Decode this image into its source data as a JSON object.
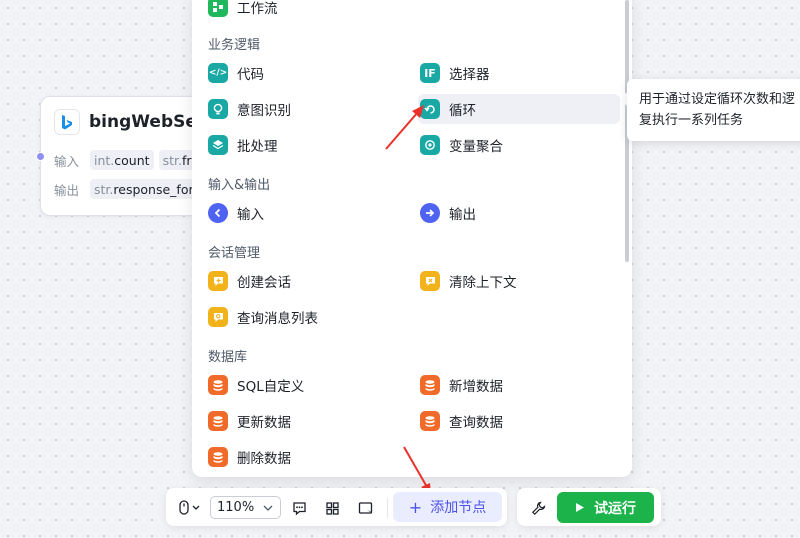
{
  "node": {
    "title": "bingWebSea",
    "input_label": "输入",
    "output_label": "输出",
    "inputs": [
      {
        "type": "int.",
        "name": "count"
      },
      {
        "type": "str.",
        "name": "fr"
      }
    ],
    "outputs": [
      {
        "type": "str.",
        "name": "response_for"
      }
    ]
  },
  "menu": {
    "top_item": "工作流",
    "sections": {
      "business": {
        "title": "业务逻辑",
        "items": [
          "代码",
          "选择器",
          "意图识别",
          "循环",
          "批处理",
          "变量聚合"
        ]
      },
      "io": {
        "title": "输入&输出",
        "items": [
          "输入",
          "输出"
        ]
      },
      "session": {
        "title": "会话管理",
        "items": [
          "创建会话",
          "清除上下文",
          "查询消息列表"
        ]
      },
      "database": {
        "title": "数据库",
        "items": [
          "SQL自定义",
          "新增数据",
          "更新数据",
          "查询数据",
          "删除数据"
        ]
      }
    },
    "icon_text": {
      "code": "</>",
      "selector": "IF"
    }
  },
  "tooltip": {
    "line1": "用于通过设定循环次数和逻",
    "line2": "复执行一系列任务"
  },
  "toolbar": {
    "zoom": "110%",
    "add_node": "添加节点",
    "run": "试运行"
  },
  "colors": {
    "teal": "#19a8a4",
    "green": "#20b85c",
    "blue": "#4f63f2",
    "yellow": "#f2b21a",
    "orange": "#f06a2a",
    "run": "#1bb34a",
    "accent": "#4d53e8",
    "arrow": "#e8322b"
  }
}
